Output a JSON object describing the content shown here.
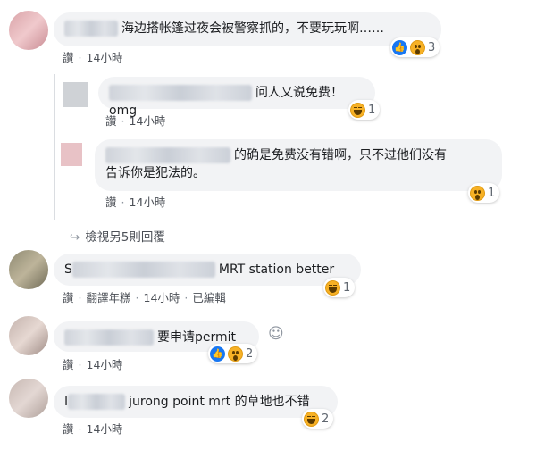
{
  "comments": [
    {
      "text": "海边搭帐篷过夜会被警察抓的，不要玩玩啊……",
      "actions": {
        "read": "讚",
        "time": "14小時"
      },
      "reactions": {
        "count": "3",
        "icons": [
          "like-icon",
          "wow-icon"
        ]
      }
    },
    {
      "text": "问人又说免费！omg",
      "actions": {
        "read": "讚",
        "time": "14小時"
      },
      "reactions": {
        "count": "1",
        "icons": [
          "haha-icon"
        ]
      }
    },
    {
      "text_line1": "的确是免费没有错啊，只不过他们没有",
      "text_line2": "告诉你是犯法的。",
      "actions": {
        "read": "讚",
        "time": "14小時"
      },
      "reactions": {
        "count": "1",
        "icons": [
          "wow-icon"
        ]
      }
    },
    {
      "prefix": "S",
      "text": "MRT station better",
      "actions": {
        "read": "讚",
        "translate": "翻譯年糕",
        "time": "14小時",
        "edited": "已編輯"
      },
      "reactions": {
        "count": "1",
        "icons": [
          "haha-icon"
        ]
      }
    },
    {
      "text": "要申请permit",
      "actions": {
        "read": "讚",
        "time": "14小時"
      },
      "reactions": {
        "count": "2",
        "icons": [
          "like-icon",
          "wow-icon"
        ]
      }
    },
    {
      "prefix": "I",
      "text": "jurong point mrt 的草地也不错",
      "actions": {
        "read": "讚",
        "time": "14小時"
      },
      "reactions": {
        "count": "2",
        "icons": [
          "haha-icon"
        ]
      }
    }
  ],
  "view_replies": "檢視另5則回覆",
  "colors": {
    "bubble": "#f2f3f5",
    "like": "#1877f2",
    "emoji": "#f7b125",
    "meta": "#4b4f56"
  }
}
